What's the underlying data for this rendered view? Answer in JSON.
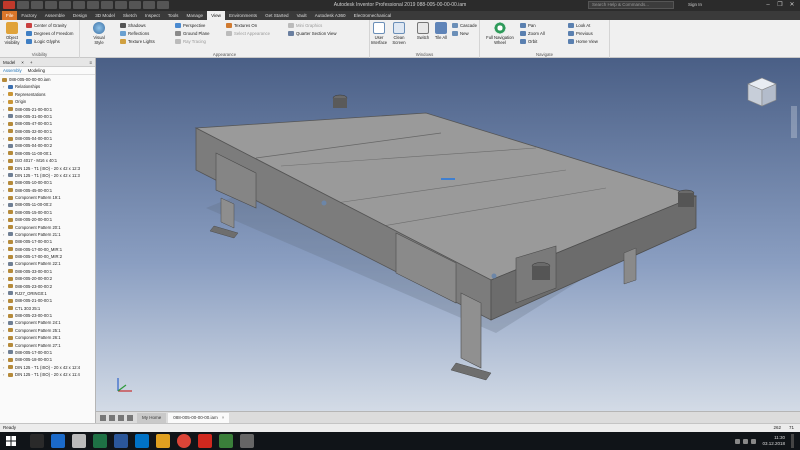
{
  "window": {
    "title": "Autodesk Inventor Professional 2019    088-005-00-00-00.iam",
    "search_placeholder": "Search Help & Commands...",
    "sign_in": "Sign In",
    "controls": [
      "–",
      "❐",
      "✕"
    ]
  },
  "ribbon_tabs": [
    "File",
    "Factory",
    "Assemble",
    "Design",
    "3D Model",
    "Sketch",
    "Inspect",
    "Tools",
    "Manage",
    "View",
    "Environments",
    "Get Started",
    "Vault",
    "Autodesk A360",
    "Electromechanical"
  ],
  "active_tab": "View",
  "ribbon": {
    "visibility": {
      "title": "Visibility",
      "object_visibility": "Object Visibility",
      "center_of_gravity": "Center of Gravity",
      "degrees_of_freedom": "Degrees of Freedom",
      "ilogic_glyphs": "iLogic Glyphs"
    },
    "appearance": {
      "title": "Appearance",
      "visual_style": "Visual Style",
      "shadows": "Shadows",
      "reflections": "Reflections",
      "texture_lights": "Texture Lights",
      "perspective": "Perspective",
      "ground_plane": "Ground Plane",
      "ray_tracing": "Ray Tracing",
      "textures_on": "Textures On",
      "select_appearance": "Select Appearance",
      "mini_graphics": "Mini Graphics",
      "quarter_section_view": "Quarter Section View"
    },
    "windows": {
      "title": "Windows",
      "user_interface": "User Interface",
      "clean_screen": "Clean Screen",
      "switch": "Switch",
      "tile_all": "Tile All",
      "cascade": "Cascade",
      "new": "New"
    },
    "navigate": {
      "title": "Navigate",
      "full_navigation_wheel": "Full Navigation Wheel",
      "pan": "Pan",
      "zoom_all": "Zoom All",
      "orbit": "Orbit",
      "look_at": "Look At",
      "previous": "Previous",
      "home_view": "Home View"
    }
  },
  "browser": {
    "tab": "Model",
    "close": "×",
    "add": "+",
    "subtabs": [
      "Assembly",
      "Modeling"
    ],
    "root": "088-005-00-00-00.iam",
    "items": [
      "Relationships",
      "Representations",
      "Origin",
      "088-005-21-00-00:1",
      "088-005-31-00-00:1",
      "088-005-47-00-00:1",
      "088-005-32-00-00:1",
      "088-005-04-00-00:1",
      "088-005-04-00-00:2",
      "088-005-11-00-00:1",
      "ISO 4017 - M16 x 40:1",
      "DIN 125 - T1 (ISO) - 20 x 42 x 12:3",
      "DIN 125 - T1 (ISO) - 20 x 42 x 11:3",
      "088-005-10-00-00:1",
      "088-005-45-00-00:1",
      "Component Pattern 19:1",
      "088-005-11-00-00:2",
      "088-005-15-00-00:1",
      "088-005-20-00-00:1",
      "Component Pattern 20:1",
      "Component Pattern 21:1",
      "088-005-17-00-00:1",
      "088-005-17-00-00_MIR:1",
      "088-005-17-00-00_MIR:2",
      "Component Pattern 22:1",
      "088-005-33-00-00:1",
      "088-005-20-00-00:2",
      "088-005-23-00-00:2",
      "RJ27_ORING0:1",
      "088-005-21-00-00:1",
      "CTL 303 25:1",
      "088-005-23-00-00:1",
      "Component Pattern 24:1",
      "Component Pattern 25:1",
      "Component Pattern 26:1",
      "Component Pattern 27:1",
      "088-005-17-00-00:1",
      "088-005-18-00-00:1",
      "DIN 125 - T1 (ISO) - 20 x 42 x 12:4",
      "DIN 125 - T1 (ISO) - 20 x 42 x 11:4"
    ]
  },
  "doc_tabs": {
    "home": "My Home",
    "document": "088-005-00-00-00.iam"
  },
  "status": {
    "text": "Ready",
    "count_a": "262",
    "count_b": "71"
  },
  "clock": {
    "time": "11:30",
    "date": "03.12.2018"
  },
  "colors": {
    "file_tab": "#d9762a",
    "viewport_top": "#4a5f86",
    "viewport_bottom": "#d3dbe6",
    "taskbar": "#101418",
    "model_body": "#8c8c8c"
  }
}
